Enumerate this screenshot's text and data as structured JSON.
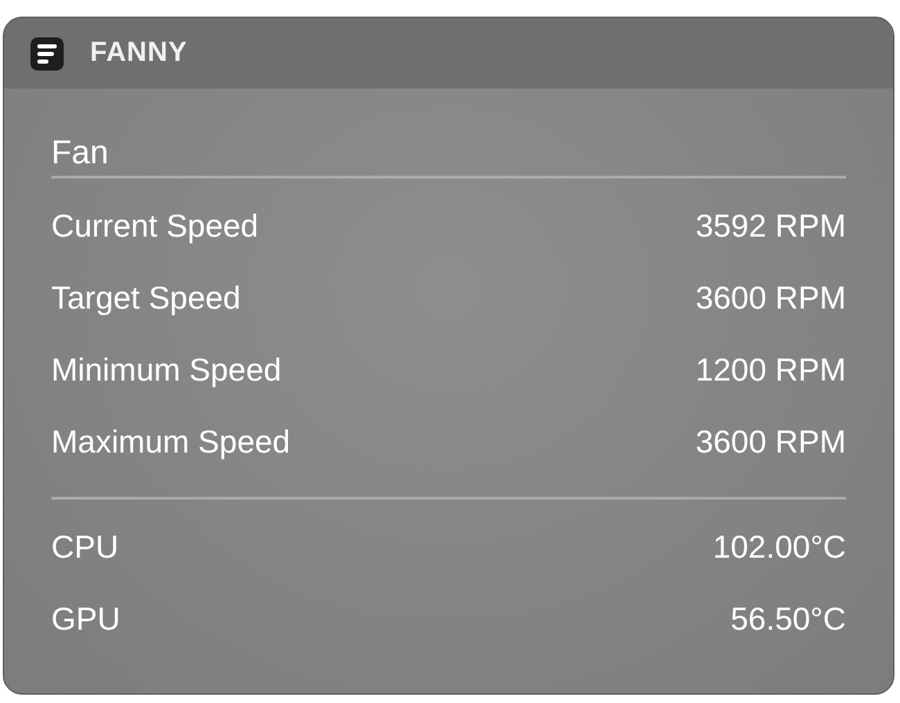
{
  "widget": {
    "title": "FANNY"
  },
  "sections": [
    {
      "title": "Fan",
      "rows": [
        {
          "label": "Current Speed",
          "value": "3592 RPM"
        },
        {
          "label": "Target Speed",
          "value": "3600 RPM"
        },
        {
          "label": "Minimum Speed",
          "value": "1200 RPM"
        },
        {
          "label": "Maximum Speed",
          "value": "3600 RPM"
        }
      ]
    },
    {
      "rows": [
        {
          "label": "CPU",
          "value": "102.00°C"
        },
        {
          "label": "GPU",
          "value": "56.50°C"
        }
      ]
    }
  ]
}
